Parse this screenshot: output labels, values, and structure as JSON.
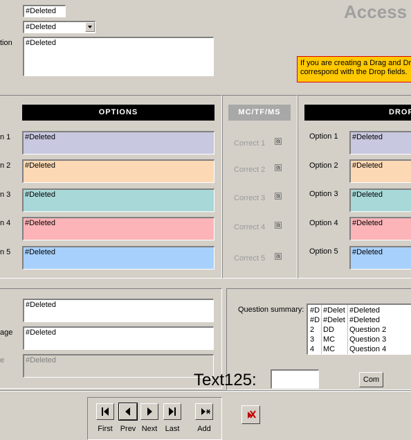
{
  "header": {
    "title": "Access",
    "field1_value": "#Deleted",
    "combo_value": "#Deleted",
    "question_label": "tion",
    "question_value": "#Deleted"
  },
  "notice": {
    "line1": "If you are creating a Drag and Dro",
    "line2": "correspond with the Drop fields."
  },
  "options_section": {
    "header": "OPTIONS",
    "rows": [
      {
        "label": "n 1",
        "value": "#Deleted",
        "color": "#c8c8e0"
      },
      {
        "label": "n 2",
        "value": "#Deleted",
        "color": "#fcd8b4"
      },
      {
        "label": "n 3",
        "value": "#Deleted",
        "color": "#a8d8d8"
      },
      {
        "label": "n 4",
        "value": "#Deleted",
        "color": "#fcb4b8"
      },
      {
        "label": "n 5",
        "value": "#Deleted",
        "color": "#a8d0fc"
      }
    ]
  },
  "mc_section": {
    "header": "MC/TF/MS",
    "correct": [
      "Correct 1",
      "Correct 2",
      "Correct 3",
      "Correct 4",
      "Correct 5"
    ]
  },
  "drop_section": {
    "header": "DROP",
    "rows": [
      {
        "label": "Option 1",
        "value": "#Deleted",
        "color": "#c8c8e0"
      },
      {
        "label": "Option 2",
        "value": "#Deleted",
        "color": "#fcd8b4"
      },
      {
        "label": "Option 3",
        "value": "#Deleted",
        "color": "#a8d8d8"
      },
      {
        "label": "Option 4",
        "value": "#Deleted",
        "color": "#fcb4b8"
      },
      {
        "label": "Option 5",
        "value": "#Deleted",
        "color": "#a8d0fc"
      }
    ]
  },
  "lower_left": {
    "field1_value": "#Deleted",
    "field2_label": "age",
    "field2_value": "#Deleted",
    "field3_label": "e",
    "field3_value": "#Deleted"
  },
  "summary": {
    "label": "Question summary:",
    "rows": [
      [
        "#D",
        "#Delet",
        "#Deleted"
      ],
      [
        "#D",
        "#Delet",
        "#Deleted"
      ],
      [
        "2",
        "DD",
        "Question 2"
      ],
      [
        "3",
        "MC",
        "Question 3"
      ],
      [
        "4",
        "MC",
        "Question 4"
      ]
    ]
  },
  "text125": {
    "label": "Text125:",
    "value": ""
  },
  "com_button": "Com",
  "nav": {
    "first": "First",
    "prev": "Prev",
    "next": "Next",
    "last": "Last",
    "add": "Add"
  }
}
